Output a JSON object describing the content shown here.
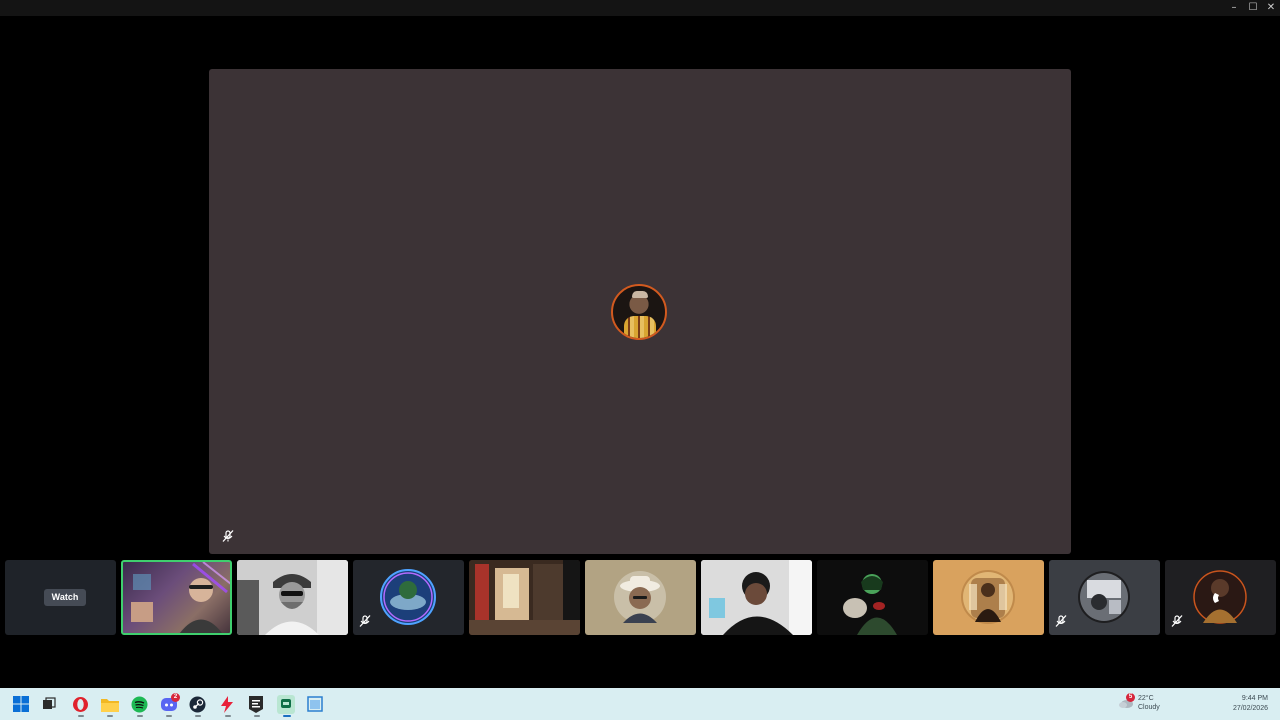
{
  "window": {
    "minimize_glyph": "–",
    "maximize_glyph": "☐",
    "close_glyph": "✕"
  },
  "stage": {
    "speaker_avatar": "speaker-avatar-image",
    "mic_state": "muted"
  },
  "participants": [
    {
      "kind": "watch",
      "button_label": "Watch"
    },
    {
      "kind": "camera",
      "active_speaker": true
    },
    {
      "kind": "camera"
    },
    {
      "kind": "avatar",
      "muted": true
    },
    {
      "kind": "camera"
    },
    {
      "kind": "avatar"
    },
    {
      "kind": "camera"
    },
    {
      "kind": "camera"
    },
    {
      "kind": "avatar"
    },
    {
      "kind": "avatar",
      "muted": true
    },
    {
      "kind": "avatar",
      "muted": true,
      "calling": true
    }
  ],
  "taskbar": {
    "icons": [
      "windows-start-icon",
      "task-view-icon",
      "opera-icon",
      "file-explorer-icon",
      "spotify-icon",
      "discord-icon",
      "steam-icon",
      "flash-app-icon",
      "epic-games-icon",
      "messenger-app-icon",
      "window-app-icon"
    ],
    "discord_badge": "2",
    "notification_badge": "5",
    "weather_temp": "22°C",
    "weather_desc": "Cloudy",
    "time": "9:44 PM",
    "date": "27/02/2026"
  },
  "colors": {
    "stage_bg": "#3c3336",
    "active_border": "#3fcf6e",
    "taskbar_bg": "#d9eef2"
  }
}
